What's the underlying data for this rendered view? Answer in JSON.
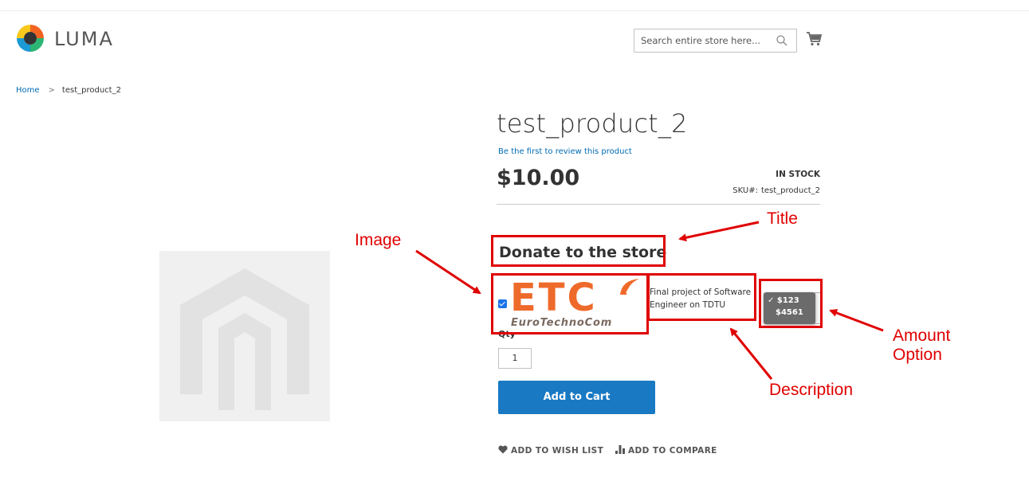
{
  "header": {
    "logo_text": "LUMA",
    "search_placeholder": "Search entire store here...",
    "search_icon": "search-icon",
    "cart_icon": "cart-icon"
  },
  "breadcrumb": {
    "items": [
      "Home",
      "test_product_2"
    ],
    "separator": ">"
  },
  "product": {
    "title": "test_product_2",
    "review_link": "Be the first to review this product",
    "price": "$10.00",
    "stock": "IN STOCK",
    "sku_label": "SKU#:",
    "sku_value": "test_product_2"
  },
  "donate": {
    "title": "Donate to the store",
    "checkbox_checked": true,
    "image_brand_text": "ETC",
    "image_tagline": "EuroTechnoCom",
    "description": "Final project of Software Engineer on TDTU",
    "amount_options": [
      "$123",
      "$4561"
    ],
    "amount_selected": "$123"
  },
  "qty": {
    "label": "Qty",
    "value": "1"
  },
  "actions": {
    "add_to_cart": "Add to Cart",
    "wishlist": "ADD TO WISH LIST",
    "compare": "ADD TO COMPARE"
  },
  "annotations": {
    "title": "Title",
    "image": "Image",
    "amount_option": "Amount\nOption",
    "description": "Description",
    "color": "#e00000"
  },
  "colors": {
    "accent_blue": "#1979c3",
    "link_blue": "#006bb4",
    "etc_orange": "#ee6a2b"
  }
}
